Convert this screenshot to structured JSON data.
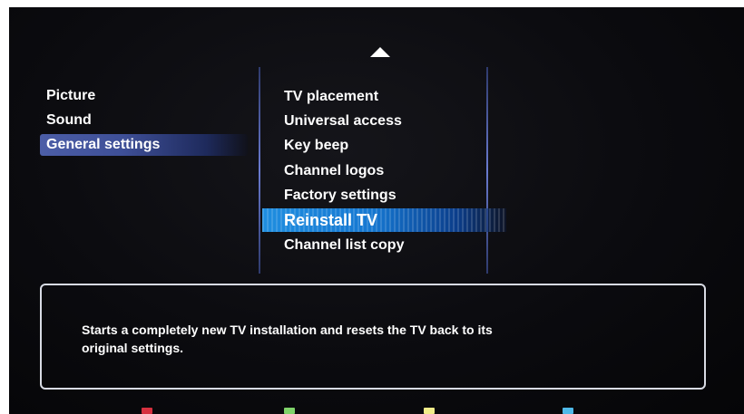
{
  "left_menu": {
    "items": [
      {
        "label": "Picture"
      },
      {
        "label": "Sound"
      },
      {
        "label": "General settings",
        "selected": true
      }
    ]
  },
  "sub_menu": {
    "items": [
      {
        "label": "TV placement"
      },
      {
        "label": "Universal access"
      },
      {
        "label": "Key beep"
      },
      {
        "label": "Channel logos"
      },
      {
        "label": "Factory settings"
      },
      {
        "label": "Reinstall TV",
        "selected": true
      },
      {
        "label": "Channel list copy"
      }
    ]
  },
  "scroll_up_icon": "triangle-up-icon",
  "description": {
    "text": "Starts a completely new TV installation and resets the TV back to its original settings."
  },
  "color_keys": [
    {
      "name": "red",
      "color": "#d6303f"
    },
    {
      "name": "green",
      "color": "#7fd36a"
    },
    {
      "name": "yellow",
      "color": "#f1ec8a"
    },
    {
      "name": "blue",
      "color": "#4fb9e8"
    }
  ],
  "colors": {
    "background": "#0b0b0f",
    "left_selection": "#4c5ea7",
    "sub_selection": "#1f8ee0",
    "text": "#ffffff"
  }
}
